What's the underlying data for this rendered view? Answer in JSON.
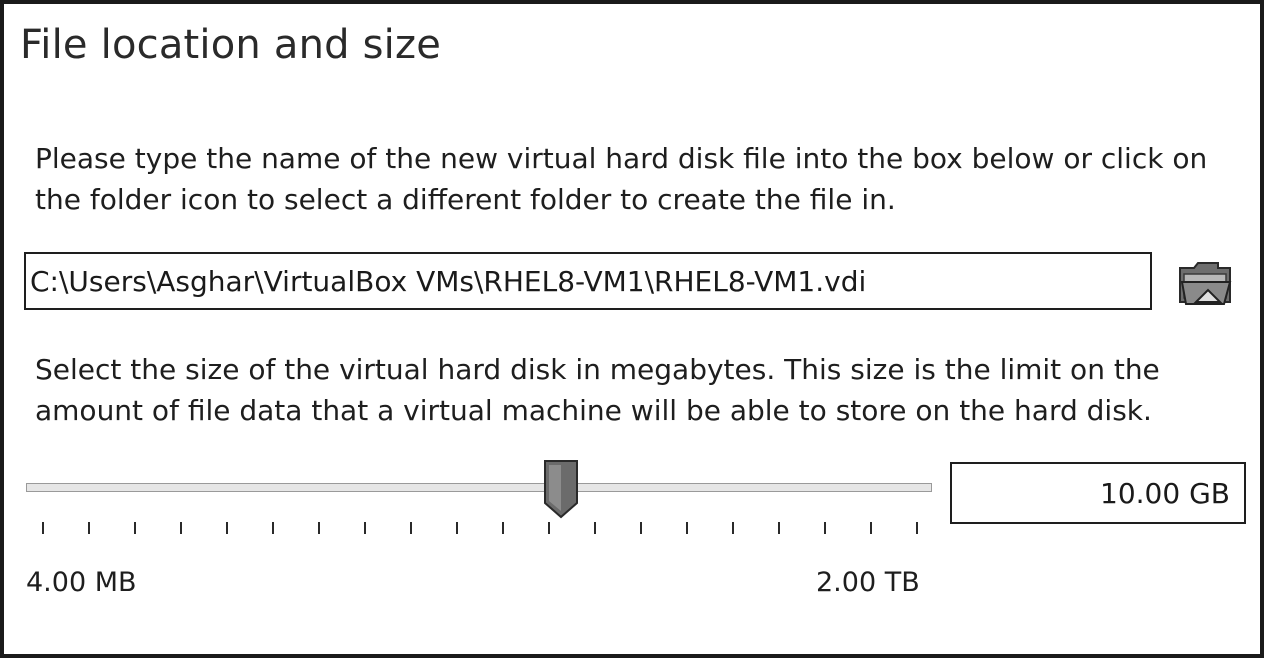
{
  "dialog": {
    "title": "File location and size",
    "location_instructions": "Please type the name of the new virtual hard disk file into the box below or click on the folder icon to select a different folder to create the file in.",
    "file_path": "C:\\Users\\Asghar\\VirtualBox VMs\\RHEL8-VM1\\RHEL8-VM1.vdi",
    "folder_button_icon": "folder-icon",
    "size_instructions": "Select the size of the virtual hard disk in megabytes. This size is the limit on the amount of file data that a virtual machine will be able to store on the hard disk.",
    "size_slider": {
      "min_label": "4.00 MB",
      "max_label": "2.00 TB",
      "position_fraction": 0.58,
      "tick_count": 20
    },
    "size_value": "10.00 GB"
  }
}
